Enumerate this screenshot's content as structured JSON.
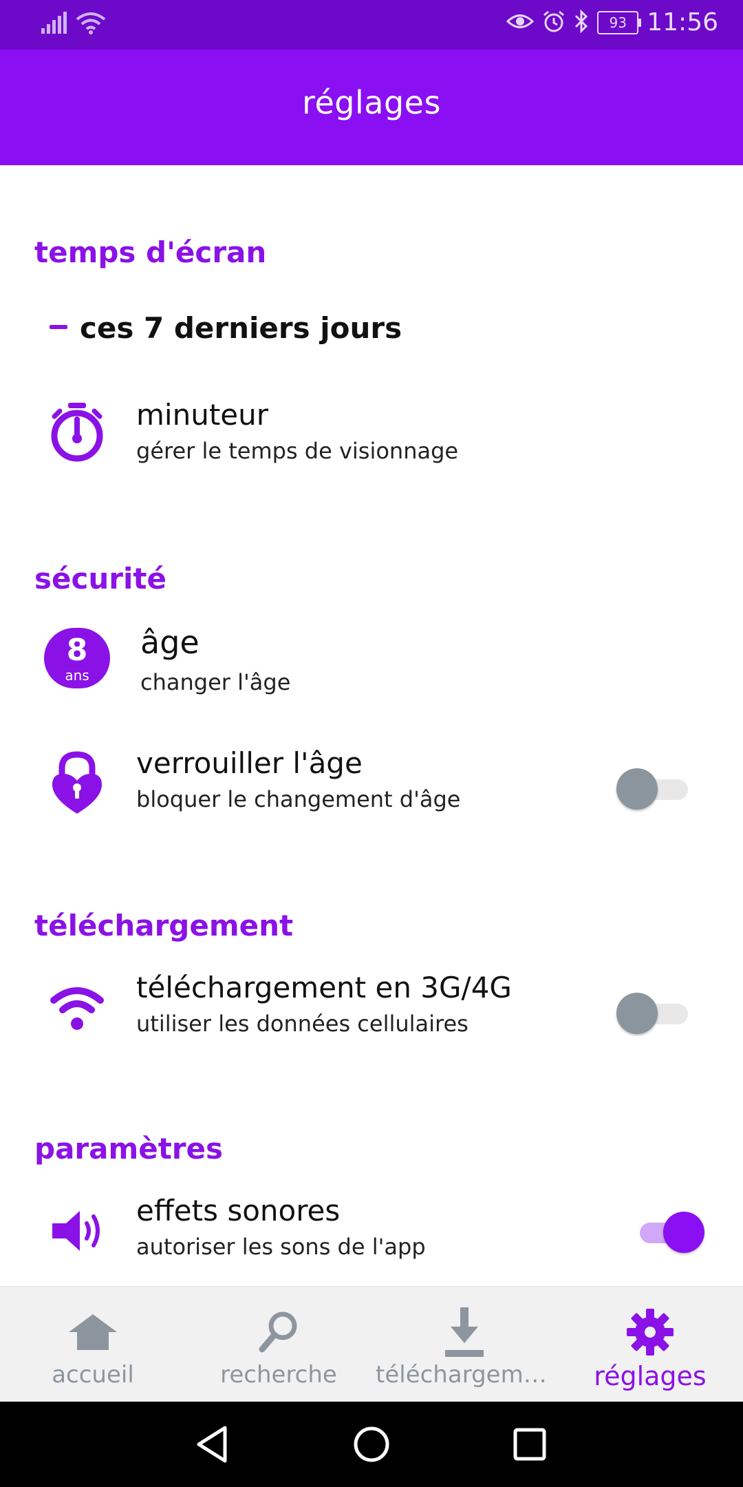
{
  "status_bar": {
    "battery": "93",
    "time": "11:56"
  },
  "header": {
    "title": "réglages"
  },
  "sections": {
    "screen_time": {
      "title": "temps d'écran",
      "summary": "ces 7 derniers jours",
      "timer": {
        "title": "minuteur",
        "subtitle": "gérer le temps de visionnage"
      }
    },
    "security": {
      "title": "sécurité",
      "age": {
        "badge_number": "8",
        "badge_unit": "ans",
        "title": "âge",
        "subtitle": "changer l'âge"
      },
      "lock_age": {
        "title": "verrouiller l'âge",
        "subtitle": "bloquer le changement d'âge",
        "enabled": false
      }
    },
    "download": {
      "title": "téléchargement",
      "cellular": {
        "title": "téléchargement en 3G/4G",
        "subtitle": "utiliser les données cellulaires",
        "enabled": false
      }
    },
    "settings": {
      "title": "paramètres",
      "sound": {
        "title": "effets sonores",
        "subtitle": "autoriser les sons de l'app",
        "enabled": true
      }
    }
  },
  "bottom_nav": {
    "items": [
      {
        "label": "accueil",
        "icon": "home-icon",
        "active": false
      },
      {
        "label": "recherche",
        "icon": "search-icon",
        "active": false
      },
      {
        "label": "téléchargeme...",
        "icon": "download-icon",
        "active": false
      },
      {
        "label": "réglages",
        "icon": "gear-icon",
        "active": true
      }
    ]
  },
  "colors": {
    "status_bar": "#6d0ac9",
    "app_bar": "#8a0ff2",
    "accent": "#8a12e6",
    "inactive": "#8d969f"
  }
}
